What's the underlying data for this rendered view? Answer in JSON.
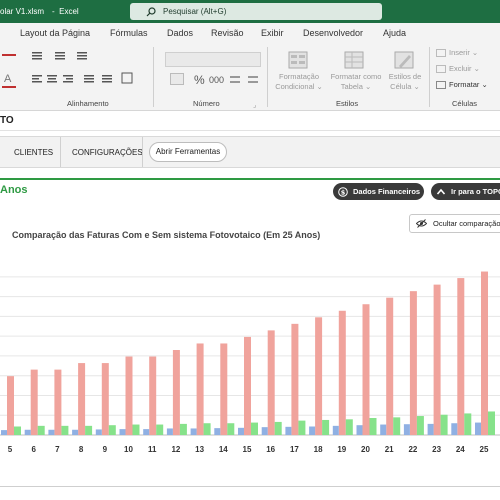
{
  "window": {
    "filename": "olar V1.xlsm",
    "app_sep": "-",
    "app_name": "Excel",
    "search_placeholder": "Pesquisar (Alt+G)"
  },
  "ribbon": {
    "tabs": [
      "Layout da Página",
      "Fórmulas",
      "Dados",
      "Revisão",
      "Exibir",
      "Desenvolvedor",
      "Ajuda"
    ],
    "groups": {
      "alinhamento": "Alinhamento",
      "numero": "Número",
      "estilos": "Estilos",
      "celulas": "Células"
    },
    "buttons": {
      "formatacao_condicional": [
        "Formatação",
        "Condicional ⌄"
      ],
      "formatar_tabela": [
        "Formatar como",
        "Tabela ⌄"
      ],
      "estilos_celula": [
        "Estilos de",
        "Célula ⌄"
      ],
      "inserir": "Inserir ⌄",
      "excluir": "Excluir ⌄",
      "formatar": "Formatar ⌄",
      "percent": "%",
      "thousands": "000"
    }
  },
  "sheet": {
    "header_fragment": "TO",
    "nav": {
      "clientes": "CLIENTES",
      "configuracoes": "CONFIGURAÇÕES",
      "abrir_ferramentas": "Abrir Ferramentas"
    },
    "section_title_fragment": "Anos",
    "buttons": {
      "dados_financeiros": "Dados Financeiros",
      "ir_para_topo": "Ir para o TOPO"
    },
    "ocultar_comparacao": "Ocultar comparação"
  },
  "colors": {
    "red_series": "#f0a39c",
    "green_series": "#86e28a",
    "blue_series": "#8fb0e3",
    "excel_green": "#1e6e42",
    "accent_green": "#2e9a43"
  },
  "chart_data": {
    "type": "bar",
    "title": "Comparação das Faturas Com e Sem sistema Fotovotaico (Em 25 Anos)",
    "categories": [
      "5",
      "6",
      "7",
      "8",
      "9",
      "10",
      "11",
      "12",
      "13",
      "14",
      "15",
      "16",
      "17",
      "18",
      "19",
      "20",
      "21",
      "22",
      "23",
      "24",
      "25"
    ],
    "series": [
      {
        "values": [
          0.9,
          1.0,
          1.0,
          1.1,
          1.1,
          1.2,
          1.2,
          1.3,
          1.4,
          1.4,
          1.5,
          1.6,
          1.7,
          1.8,
          1.9,
          2.0,
          2.1,
          2.2,
          2.3,
          2.4,
          2.5
        ]
      },
      {
        "values": [
          0.13,
          0.14,
          0.14,
          0.14,
          0.15,
          0.16,
          0.16,
          0.17,
          0.18,
          0.18,
          0.19,
          0.2,
          0.22,
          0.23,
          0.24,
          0.26,
          0.27,
          0.29,
          0.31,
          0.33,
          0.36
        ]
      },
      {
        "values": [
          0.075,
          0.08,
          0.08,
          0.08,
          0.085,
          0.09,
          0.09,
          0.1,
          0.1,
          0.105,
          0.11,
          0.12,
          0.125,
          0.13,
          0.14,
          0.15,
          0.16,
          0.165,
          0.17,
          0.18,
          0.19
        ]
      }
    ],
    "ylim": [
      0,
      2.6
    ],
    "grid": true,
    "legend": "none"
  }
}
